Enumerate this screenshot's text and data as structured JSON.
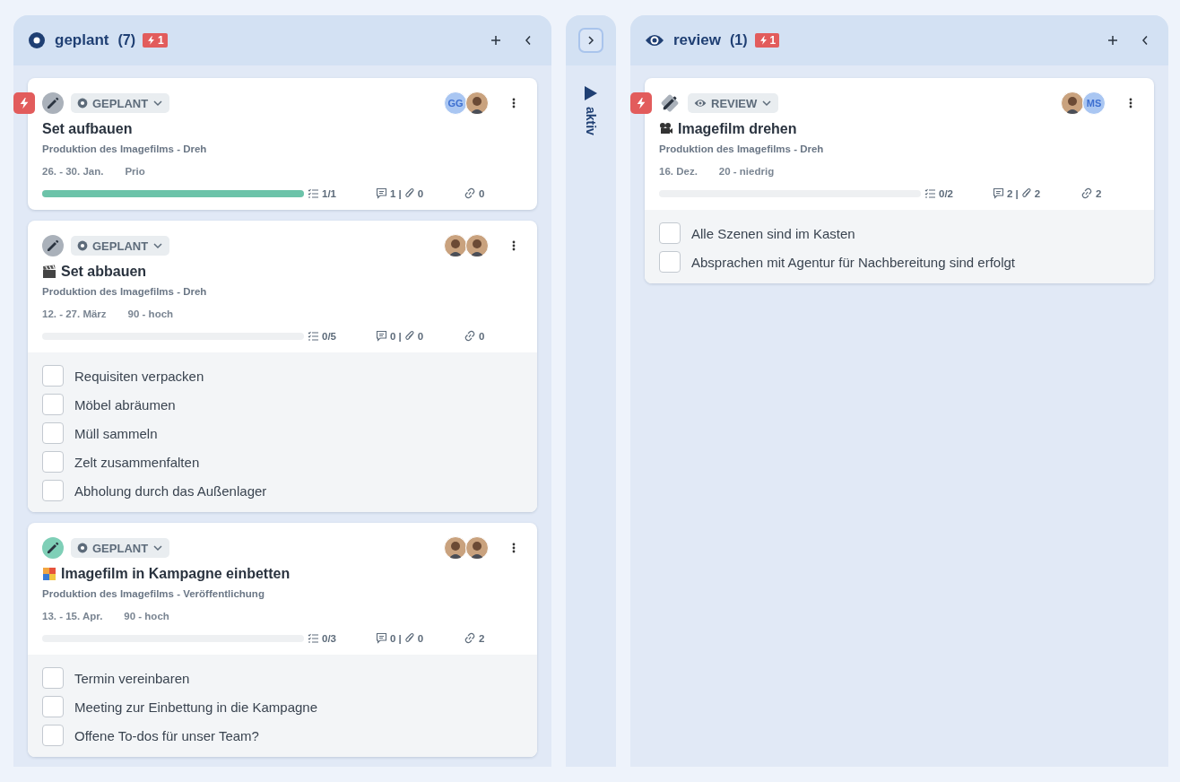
{
  "columns": [
    {
      "kind": "planned",
      "title": "geplant",
      "count": "(7)",
      "urgent_count": "1",
      "cards": [
        {
          "urgent": true,
          "edit_button": {
            "kind": "circle",
            "active": false
          },
          "status": {
            "kind": "planned",
            "label": "GEPLANT"
          },
          "assignees": [
            {
              "kind": "initials",
              "initials": "GG"
            },
            {
              "kind": "photo"
            }
          ],
          "title": "Set aufbauen",
          "project": "Produktion des Imagefilms - Dreh",
          "date": "26. - 30. Jan.",
          "priority": "Prio",
          "level": 1,
          "checklist": "1/1",
          "comments": "1",
          "separator": "|",
          "attachments": "0",
          "links": "0"
        },
        {
          "urgent": false,
          "edit_button": {
            "kind": "circle",
            "active": false
          },
          "status": {
            "kind": "planned",
            "label": "GEPLANT"
          },
          "assignees": [
            {
              "kind": "photo"
            },
            {
              "kind": "photo"
            }
          ],
          "title_icon": {
            "kind": "clapper"
          },
          "title": "Set abbauen",
          "project": "Produktion des Imagefilms - Dreh",
          "date": "12. - 27. März",
          "priority": "90 - hoch",
          "level": 0,
          "checklist": "0/5",
          "comments": "0",
          "separator": "|",
          "attachments": "0",
          "links": "0",
          "items": [
            {
              "label": "Requisiten verpacken",
              "checked": false
            },
            {
              "label": "Möbel abräumen",
              "checked": false
            },
            {
              "label": "Müll sammeln",
              "checked": false
            },
            {
              "label": "Zelt zusammenfalten",
              "checked": false
            },
            {
              "label": "Abholung durch das Außenlager",
              "checked": false
            }
          ]
        },
        {
          "urgent": false,
          "edit_button": {
            "kind": "circle",
            "active": true
          },
          "status": {
            "kind": "planned",
            "label": "GEPLANT"
          },
          "assignees": [
            {
              "kind": "photo"
            },
            {
              "kind": "photo"
            }
          ],
          "title_icon": {
            "kind": "puzzle"
          },
          "title": "Imagefilm in Kampagne einbetten",
          "project": "Produktion des Imagefilms - Veröffentlichung",
          "date": "13. - 15. Apr.",
          "priority": "90 - hoch",
          "level": 0,
          "checklist": "0/3",
          "comments": "0",
          "separator": "|",
          "attachments": "0",
          "links": "2",
          "items": [
            {
              "label": "Termin vereinbaren",
              "checked": false
            },
            {
              "label": "Meeting zur Einbettung in die Kampagne",
              "checked": false
            },
            {
              "label": "Offene To-dos für unser Team?",
              "checked": false
            }
          ]
        }
      ]
    },
    {
      "kind": "collapsed",
      "label": "aktiv"
    },
    {
      "kind": "review",
      "title": "review",
      "count": "(1)",
      "urgent_count": "1",
      "cards": [
        {
          "urgent": true,
          "edit_button": {
            "kind": "diamond",
            "active": false
          },
          "status": {
            "kind": "review",
            "label": "REVIEW"
          },
          "assignees": [
            {
              "kind": "photo"
            },
            {
              "kind": "initials",
              "initials": "MS"
            }
          ],
          "title_icon": {
            "kind": "camera"
          },
          "title": "Imagefilm drehen",
          "project": "Produktion des Imagefilms - Dreh",
          "date": "16. Dez.",
          "priority": "20 - niedrig",
          "level": 0,
          "checklist": "0/2",
          "comments": "2",
          "separator": "|",
          "attachments": "2",
          "links": "2",
          "items": [
            {
              "label": "Alle Szenen sind im Kasten",
              "checked": false
            },
            {
              "label": "Absprachen mit Agentur für Nachbereitung sind erfolgt",
              "checked": false
            }
          ]
        }
      ]
    }
  ]
}
